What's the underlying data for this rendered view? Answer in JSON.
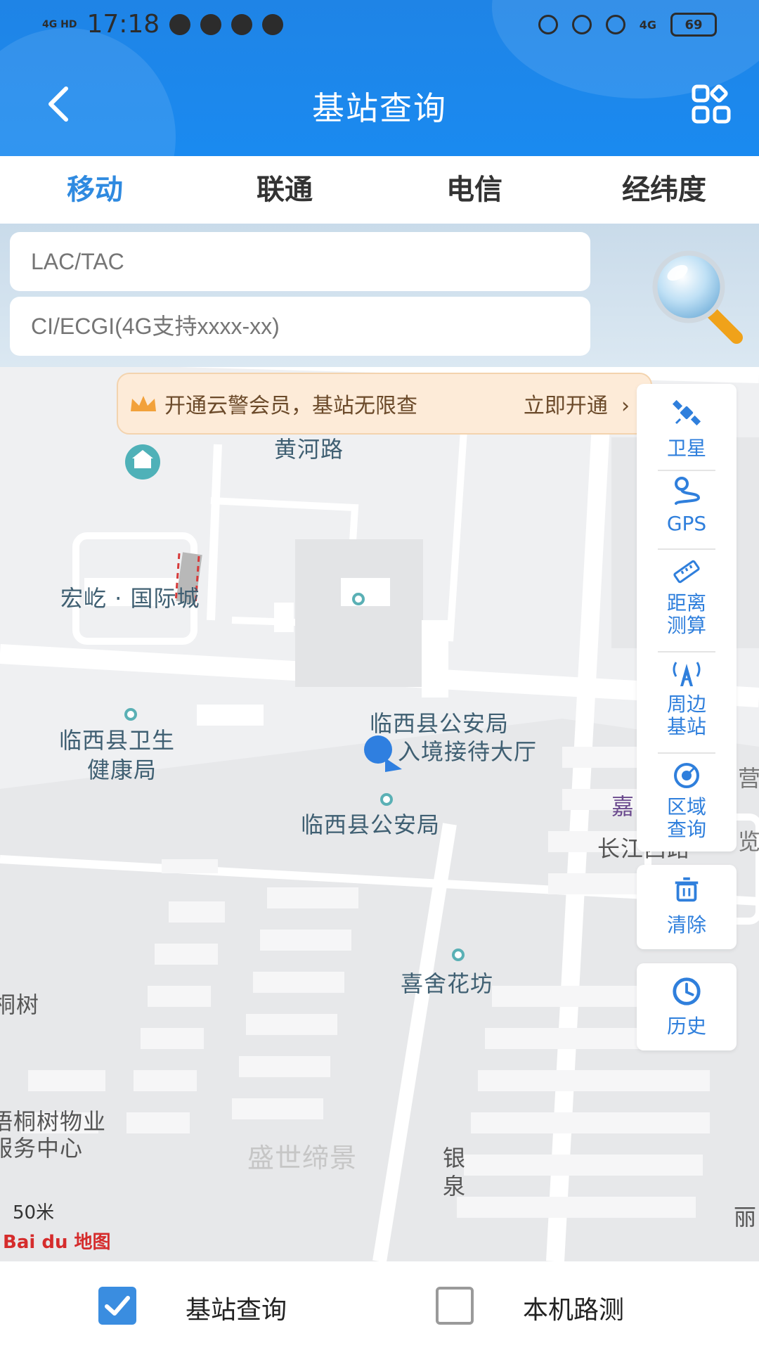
{
  "status_bar": {
    "network": "4G HD",
    "time": "17:18",
    "battery": "69",
    "signal_right": "4G"
  },
  "header": {
    "title": "基站查询",
    "back_icon": "chevron-left-icon",
    "menu_icon": "grid-icon"
  },
  "tabs": [
    {
      "label": "移动",
      "active": true
    },
    {
      "label": "联通",
      "active": false
    },
    {
      "label": "电信",
      "active": false
    },
    {
      "label": "经纬度",
      "active": false
    }
  ],
  "search": {
    "lac_placeholder": "LAC/TAC",
    "ci_placeholder": "CI/ECGI(4G支持xxxx-xx)"
  },
  "promo": {
    "text": "开通云警会员，基站无限查",
    "cta": "立即开通",
    "arrow": "›"
  },
  "tools": [
    {
      "label": "卫星",
      "icon": "satellite-icon"
    },
    {
      "label": "GPS",
      "icon": "gps-icon"
    },
    {
      "label": "距离\n测算",
      "icon": "ruler-icon"
    },
    {
      "label": "周边\n基站",
      "icon": "antenna-icon"
    },
    {
      "label": "区域\n查询",
      "icon": "area-icon"
    },
    {
      "label": "清除",
      "icon": "trash-icon"
    },
    {
      "label": "历史",
      "icon": "clock-icon"
    }
  ],
  "map": {
    "labels": {
      "huanghe": "黄河路",
      "hongyi": "宏屹 · 国际城",
      "weisheng_1": "临西县卫生",
      "weisheng_2": "健康局",
      "gonganju_rj_1": "临西县公安局",
      "gonganju_rj_2": "入境接待大厅",
      "gonganju": "临西县公安局",
      "jia": "嘉",
      "changjiang": "长江西路",
      "xishe": "喜舍花坊",
      "tongshu": "桐树",
      "wuye_1": "梧桐树物业",
      "wuye_2": "服务中心",
      "shengshi": "盛世缔景",
      "yin": "银",
      "quan": "泉",
      "li": "丽",
      "lan": "览",
      "jian": "营"
    },
    "scale": "50米",
    "logo": "Bai du 地图"
  },
  "bottom": {
    "option1": {
      "label": "基站查询",
      "checked": true
    },
    "option2": {
      "label": "本机路测",
      "checked": false
    }
  }
}
